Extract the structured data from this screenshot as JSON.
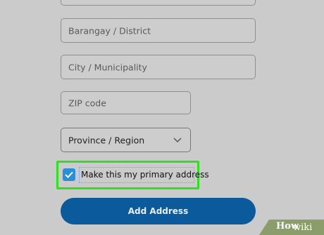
{
  "form": {
    "barangay_placeholder": "Barangay / District",
    "city_placeholder": "City / Municipality",
    "zip_placeholder": "ZIP code",
    "province_value": "Province / Region",
    "primary_checkbox_label": "Make this my primary address",
    "primary_checkbox_checked": true,
    "submit_label": "Add Address"
  },
  "colors": {
    "checkbox": "#2a8fd6",
    "button": "#0a5a9c",
    "highlight": "#2ee11d"
  },
  "watermark": {
    "prefix": "wiki",
    "suffix": "How"
  }
}
